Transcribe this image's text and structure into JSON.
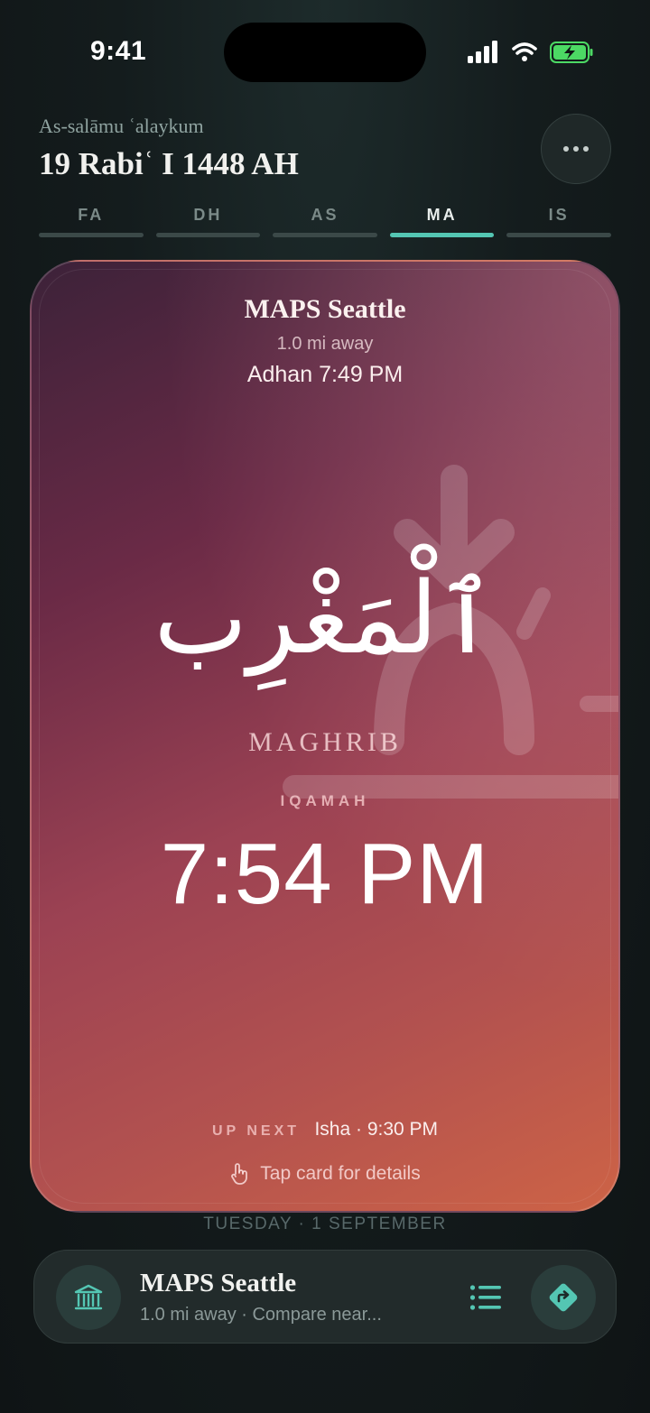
{
  "status_bar": {
    "time": "9:41"
  },
  "header": {
    "greeting": "As-salāmu ʿalaykum",
    "hijri_date": "19 Rabiʿ I 1448 AH"
  },
  "prayer_tabs": [
    {
      "label": "FA",
      "active": false
    },
    {
      "label": "DH",
      "active": false
    },
    {
      "label": "AS",
      "active": false
    },
    {
      "label": "MA",
      "active": true
    },
    {
      "label": "IS",
      "active": false
    }
  ],
  "card": {
    "masjid_name": "MAPS Seattle",
    "distance": "1.0 mi away",
    "adhan": "Adhan 7:49 PM",
    "arabic_name": "ٱلْمَغْرِب",
    "english_name": "MAGHRIB",
    "iqamah_label": "IQAMAH",
    "iqamah_time": "7:54 PM",
    "up_next_label": "UP NEXT",
    "up_next_value": "Isha · 9:30 PM",
    "tap_hint": "Tap card for details"
  },
  "date_line": "TUESDAY · 1 SEPTEMBER",
  "bottom_bar": {
    "title": "MAPS Seattle",
    "subtitle": "1.0 mi away · Compare near..."
  },
  "colors": {
    "accent": "#54c6b3",
    "card_start": "#3c2239",
    "card_end": "#cd6346",
    "battery": "#4cd964"
  },
  "icons": {
    "signal": "cellular-signal-icon",
    "wifi": "wifi-icon",
    "battery": "battery-charging-icon",
    "more": "ellipsis-icon",
    "sunset": "sunset-icon",
    "tap": "hand-tap-icon",
    "masjid": "masjid-building-icon",
    "list": "list-icon",
    "directions": "directions-icon"
  }
}
